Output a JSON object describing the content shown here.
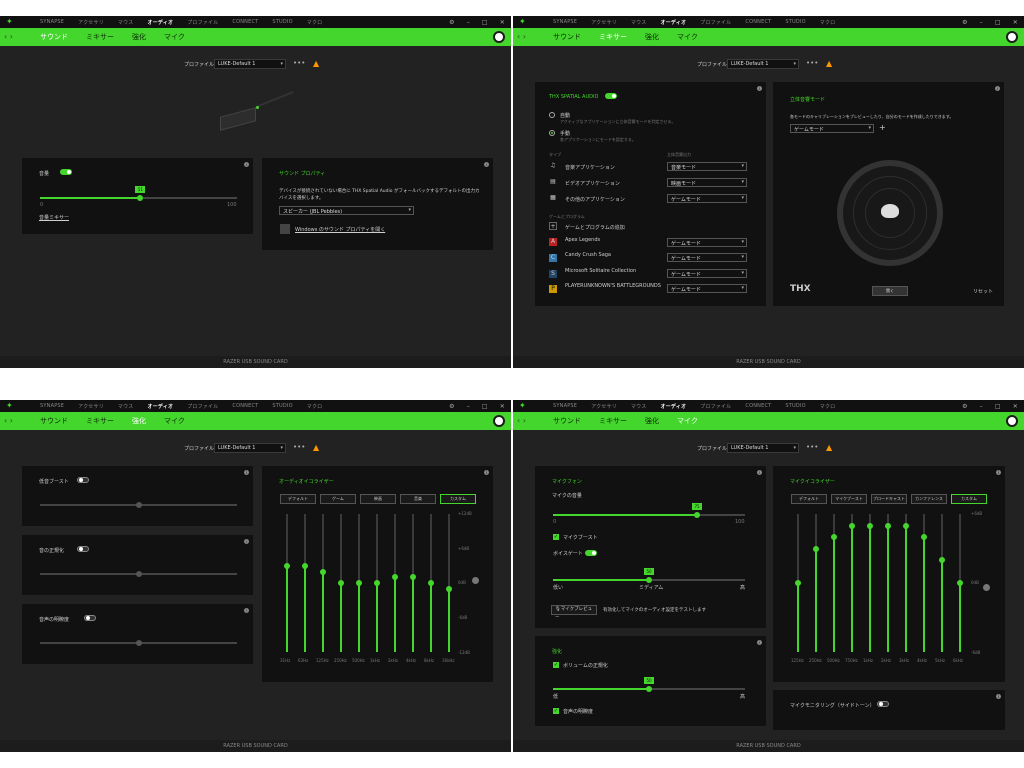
{
  "nav": {
    "items": [
      "SYNAPSE",
      "アクセサリ",
      "マウス",
      "オーディオ",
      "プロファイル",
      "CONNECT",
      "STUDIO",
      "マクロ"
    ]
  },
  "subtabs": [
    "サウンド",
    "ミキサー",
    "強化",
    "マイク"
  ],
  "profile": {
    "label": "プロファイル",
    "value": "LUKE-Default 1"
  },
  "footer": "RAZER USB SOUND CARD",
  "sound": {
    "volume_label": "音量",
    "volume": "51",
    "min": "0",
    "max": "100",
    "mixer_link": "音量ミキサー",
    "props_title": "サウンド プロパティ",
    "props_desc": "デバイスが接続されていない場合に THX Spatial Audio がフォールバックするデフォルトの出力カ",
    "props_desc2": "バイスを選択します。",
    "speaker": "スピーカー (JBL Pebbles)",
    "win_link": "Windows のサウンド プロパティを開く"
  },
  "mixer": {
    "title": "THX SPATIAL AUDIO",
    "auto": "自動",
    "auto_desc": "アクティブなアプリケーションに立体音響モードを判定させる。",
    "manual": "手動",
    "manual_desc": "各アプリケーションにモードを設定する。",
    "col_type": "タイプ",
    "col_mode": "立体音響出力",
    "types": [
      {
        "name": "音楽アプリケーション",
        "mode": "音楽モード"
      },
      {
        "name": "ビデオアプリケーション",
        "mode": "映画モード"
      },
      {
        "name": "その他のアプリケーション",
        "mode": "ゲームモード"
      }
    ],
    "games_label": "ゲームとプログラム",
    "add_game": "ゲームとプログラムの追加",
    "games": [
      {
        "name": "Apex Legends",
        "mode": "ゲームモード"
      },
      {
        "name": "Candy Crush Saga",
        "mode": "ゲームモード"
      },
      {
        "name": "Microsoft Solitaire Collection",
        "mode": "ゲームモード"
      },
      {
        "name": "PLAYERUNKNOWN'S BATTLEGROUNDS",
        "mode": "ゲームモード"
      }
    ],
    "spatial_title": "立体音響モード",
    "spatial_desc": "各モードのキャリブレーションをプレビューしたり、自分のモードを作成したりできます。",
    "spatial_mode": "ゲームモード",
    "thx": "THX",
    "listen": "聞く",
    "reset": "リセット"
  },
  "enhance": {
    "bass": "低音ブースト",
    "norm": "音の正規化",
    "clarity": "音声の明瞭度",
    "eq_title": "オーディオイコライザー",
    "presets": [
      "デフォルト",
      "ゲーム",
      "映画",
      "音楽",
      "カスタム"
    ],
    "scale": [
      "+12dB",
      "+6dB",
      "0dB",
      "-6dB",
      "-12dB"
    ],
    "bands": [
      "31Hz",
      "63Hz",
      "125Hz",
      "250Hz",
      "500Hz",
      "1kHz",
      "2kHz",
      "4kHz",
      "8kHz",
      "16kHz"
    ],
    "gains": [
      3,
      3,
      2,
      0,
      0,
      0,
      1,
      1,
      0,
      -1
    ]
  },
  "mic": {
    "title": "マイクフォン",
    "vol_label": "マイクの音量",
    "vol": "75",
    "min": "0",
    "max": "100",
    "boost": "マイクブースト",
    "gate": "ボイスゲート",
    "low": "低い",
    "mid": "ミディアム",
    "high": "高",
    "gate_val": "50",
    "preview": "マイクプレビュー",
    "preview_desc": "有効化してマイクのオーディオ設定をテストします",
    "enh_title": "強化",
    "vnorm": "ボリュームの正規化",
    "vnorm_val": "50",
    "low2": "低",
    "high2": "高",
    "clarity": "音声の明瞭度",
    "eq_title": "マイクイコライザー",
    "presets": [
      "デフォルト",
      "マイクブースト",
      "ブロードキャスト",
      "カンファレンス",
      "カスタム"
    ],
    "scale": [
      "+6dB",
      "0dB",
      "-6dB"
    ],
    "bands": [
      "125Hz",
      "250Hz",
      "500Hz",
      "750Hz",
      "1kHz",
      "2kHz",
      "3kHz",
      "4kHz",
      "5kHz",
      "6kHz"
    ],
    "gains": [
      0,
      3,
      4,
      5,
      5,
      5,
      5,
      4,
      2,
      0
    ],
    "monitor": "マイクモニタリング（サイドトーン）"
  }
}
